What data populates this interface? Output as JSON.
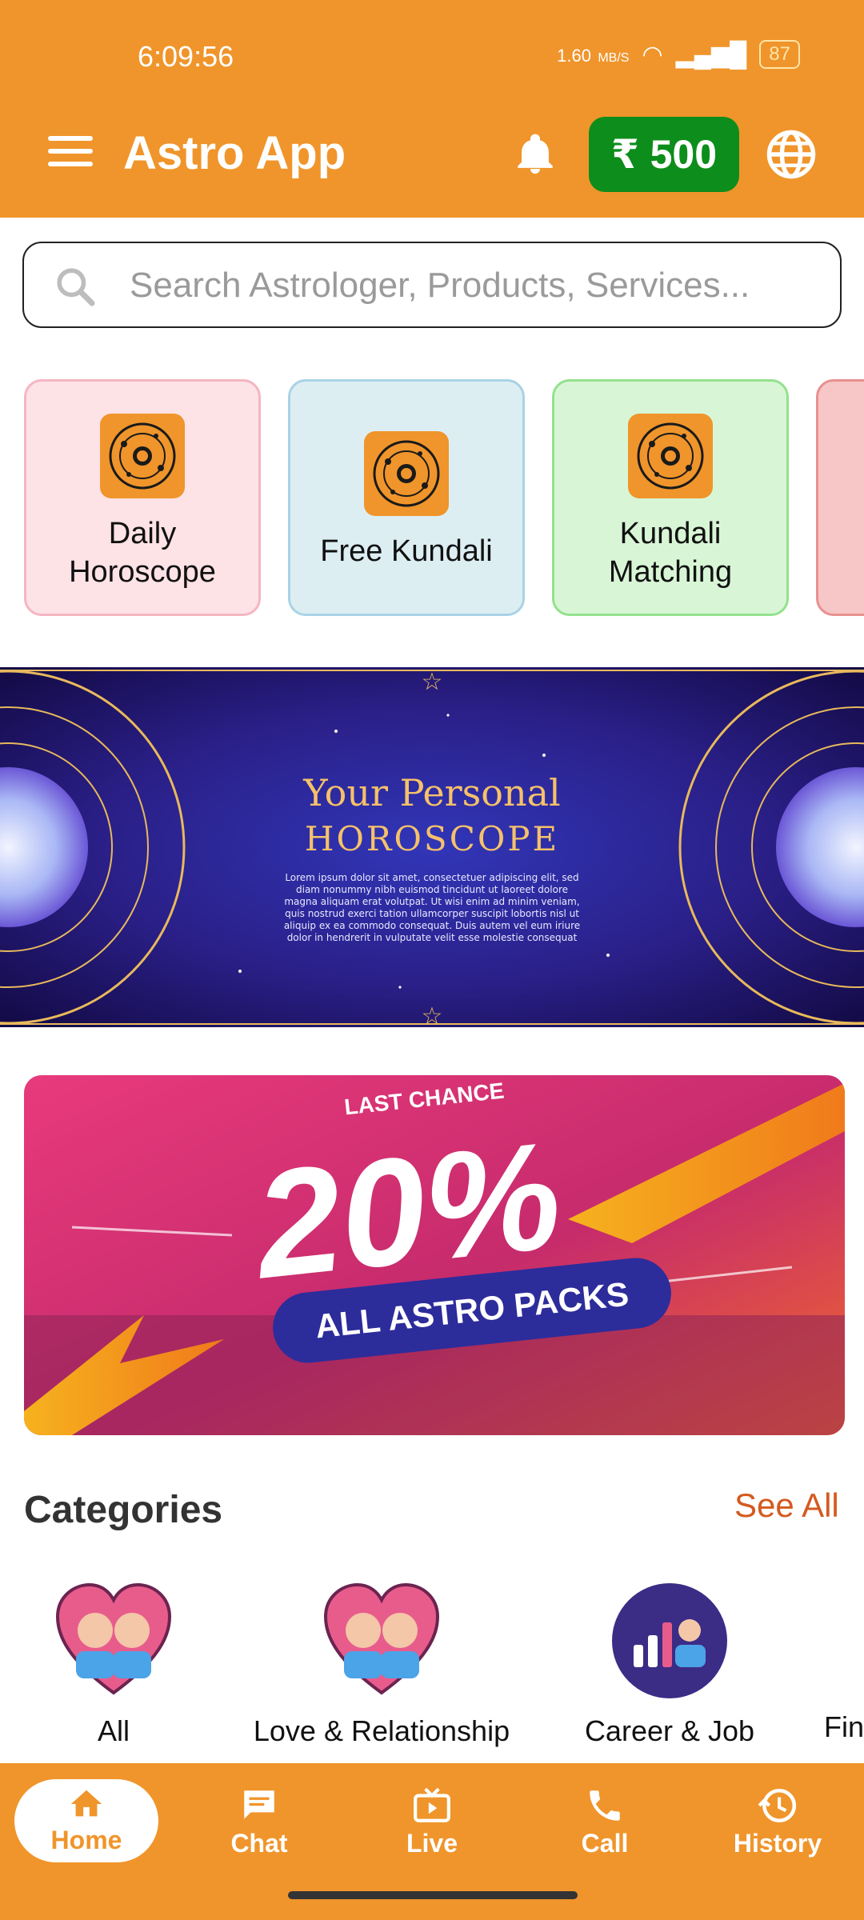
{
  "status_bar": {
    "time": "6:09:56",
    "net_speed_value": "1.60",
    "net_speed_unit": "MB/S",
    "battery": "87"
  },
  "header": {
    "title": "Astro App",
    "wallet": "₹ 500"
  },
  "search": {
    "placeholder": "Search Astrologer, Products, Services..."
  },
  "quick_cards": [
    {
      "label": "Daily Horoscope",
      "bg": "#FDE2E6",
      "border": "#F4B6C1"
    },
    {
      "label": "Free Kundali",
      "bg": "#DDEEF3",
      "border": "#A9D3E5"
    },
    {
      "label": "Kundali Matching",
      "bg": "#D8F6D6",
      "border": "#94E18E"
    },
    {
      "label": "",
      "bg": "#F7C6C6",
      "border": "#E99090"
    }
  ],
  "banner1": {
    "title_line1": "Your Personal",
    "title_line2": "HOROSCOPE",
    "body": "Lorem ipsum dolor sit amet, consectetuer adipiscing elit, sed diam nonummy nibh euismod tincidunt ut laoreet dolore magna aliquam erat volutpat. Ut wisi enim ad minim veniam, quis nostrud exerci tation ullamcorper suscipit lobortis nisl ut aliquip ex ea commodo consequat. Duis autem vel eum iriure dolor in hendrerit in vulputate velit esse molestie consequat"
  },
  "banner2": {
    "last_chance": "LAST CHANCE",
    "percent": "20%",
    "pill": "ALL ASTRO PACKS"
  },
  "categories": {
    "title": "Categories",
    "see_all": "See All",
    "items": [
      "All",
      "Love & Relationship",
      "Career & Job",
      "Fin"
    ]
  },
  "bottom_nav": [
    {
      "label": "Home"
    },
    {
      "label": "Chat"
    },
    {
      "label": "Live"
    },
    {
      "label": "Call"
    },
    {
      "label": "History"
    }
  ],
  "colors": {
    "primary": "#F0952B",
    "wallet_green": "#0D8D1B",
    "see_all": "#D45A1F",
    "banner2_navy": "#2D2C9B"
  },
  "icons": [
    "menu-icon",
    "bell-icon",
    "globe-icon",
    "search-icon",
    "zodiac-wheel-icon",
    "heart-couple-icon",
    "career-icon",
    "home-icon",
    "chat-icon",
    "live-tv-icon",
    "phone-icon",
    "history-icon"
  ]
}
